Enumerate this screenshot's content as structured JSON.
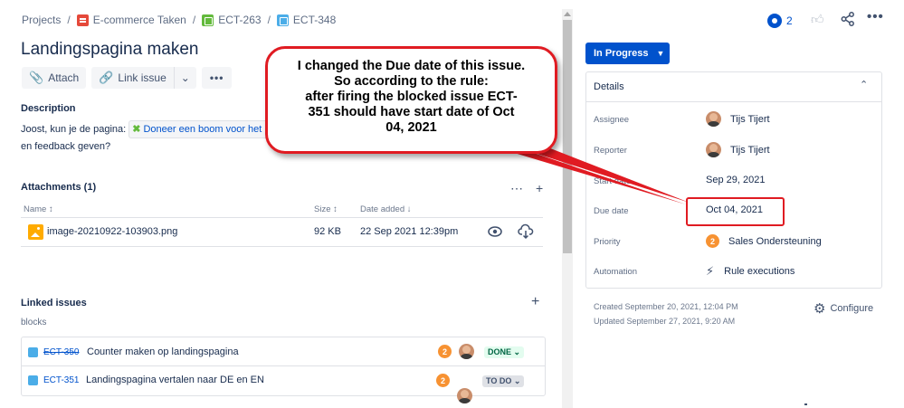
{
  "breadcrumb": {
    "items": [
      "Projects",
      "E-commerce Taken",
      "ECT-263",
      "ECT-348"
    ],
    "sep": "/"
  },
  "issue": {
    "title": "Landingspagina maken"
  },
  "toolbar": {
    "attach": "Attach",
    "link_issue": "Link issue",
    "more": "•••"
  },
  "description": {
    "heading": "Description",
    "text_before": "Joost, kun je de pagina:",
    "link_text": "Doneer een boom voor het pr",
    "text_after": "en feedback geven?"
  },
  "attachments": {
    "heading": "Attachments (1)",
    "columns": {
      "name": "Name",
      "size": "Size",
      "date": "Date added"
    },
    "rows": [
      {
        "name": "image-20210922-103903.png",
        "size": "92 KB",
        "date": "22 Sep 2021 12:39pm"
      }
    ]
  },
  "linked_issues": {
    "heading": "Linked issues",
    "relation": "blocks",
    "items": [
      {
        "key": "ECT-350",
        "summary": "Counter maken op landingspagina",
        "priority": "2",
        "status": "DONE"
      },
      {
        "key": "ECT-351",
        "summary": "Landingspagina vertalen naar DE en EN",
        "priority": "2",
        "status": "TO DO"
      }
    ]
  },
  "header_right": {
    "watchers": "2"
  },
  "status": {
    "label": "In Progress"
  },
  "details": {
    "heading": "Details",
    "fields": {
      "assignee": {
        "label": "Assignee",
        "value": "Tijs Tijert"
      },
      "reporter": {
        "label": "Reporter",
        "value": "Tijs Tijert"
      },
      "start": {
        "label": "Start date",
        "value": "Sep 29, 2021"
      },
      "due": {
        "label": "Due date",
        "value": "Oct 04, 2021"
      },
      "priority": {
        "label": "Priority",
        "value": "Sales Ondersteuning",
        "badge": "2"
      },
      "automation": {
        "label": "Automation",
        "value": "Rule executions"
      }
    }
  },
  "meta": {
    "created": "Created September 20, 2021, 12:04 PM",
    "updated": "Updated September 27, 2021, 9:20 AM",
    "configure": "Configure"
  },
  "annotation": {
    "lines": [
      "I changed the Due date of this issue.",
      "So according to the rule:",
      "after firing the blocked issue ECT-",
      "351 should have start date of Oct",
      "04, 2021"
    ],
    "color": "#e01b22"
  },
  "colors": {
    "primary": "#0052cc",
    "text": "#172b4d",
    "subtle": "#5e6c84",
    "priority_medium": "#f79232"
  }
}
